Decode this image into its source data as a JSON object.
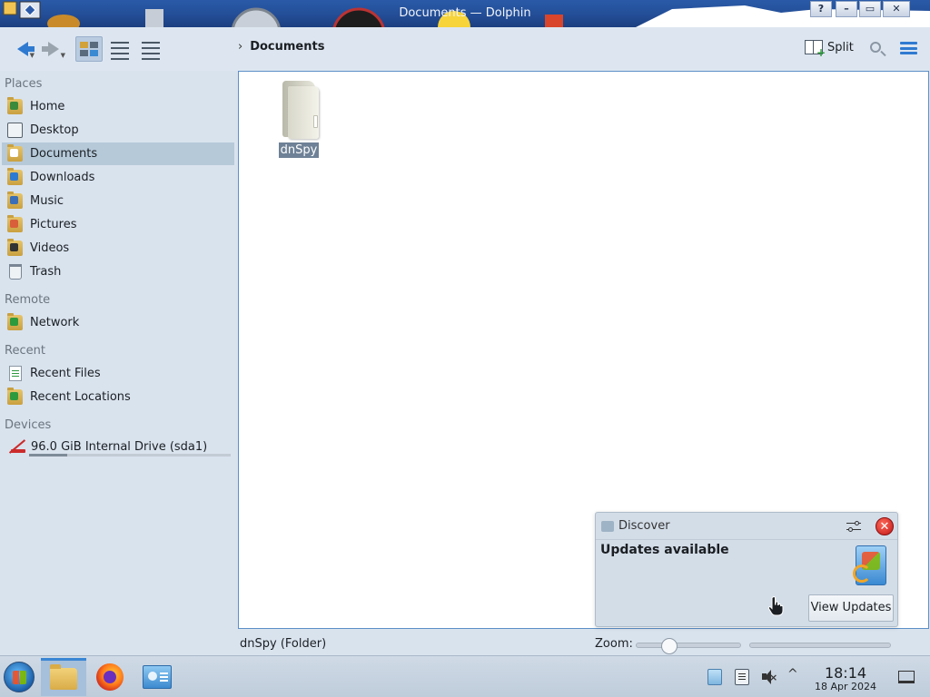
{
  "window": {
    "title": "Documents — Dolphin",
    "buttons": {
      "help": "?",
      "minimize": "–",
      "maximize": "▭",
      "close": "✕"
    }
  },
  "toolbar": {
    "back_icon": "arrow-left-icon",
    "forward_icon": "arrow-right-icon",
    "view_modes": [
      "icons",
      "compact",
      "details"
    ],
    "active_view": "icons",
    "breadcrumb": [
      "Documents"
    ],
    "split_label": "Split",
    "search_icon": "search-icon",
    "menu_icon": "hamburger-menu-icon"
  },
  "sidebar": {
    "sections": {
      "places": "Places",
      "remote": "Remote",
      "recent": "Recent",
      "devices": "Devices"
    },
    "places": [
      {
        "label": "Home",
        "icon": "home-folder-icon"
      },
      {
        "label": "Desktop",
        "icon": "desktop-icon"
      },
      {
        "label": "Documents",
        "icon": "documents-folder-icon",
        "selected": true
      },
      {
        "label": "Downloads",
        "icon": "downloads-folder-icon"
      },
      {
        "label": "Music",
        "icon": "music-folder-icon"
      },
      {
        "label": "Pictures",
        "icon": "pictures-folder-icon"
      },
      {
        "label": "Videos",
        "icon": "videos-folder-icon"
      },
      {
        "label": "Trash",
        "icon": "trash-icon"
      }
    ],
    "remote": [
      {
        "label": "Network",
        "icon": "network-folder-icon"
      }
    ],
    "recent": [
      {
        "label": "Recent Files",
        "icon": "recent-files-icon"
      },
      {
        "label": "Recent Locations",
        "icon": "recent-locations-icon"
      }
    ],
    "devices": [
      {
        "label": "96.0 GiB Internal Drive (sda1)",
        "icon": "drive-icon",
        "usage_fraction": 0.19
      }
    ]
  },
  "main": {
    "items": [
      {
        "name": "dnSpy",
        "type": "folder",
        "selected": true
      }
    ]
  },
  "statusbar": {
    "text": "dnSpy (Folder)",
    "zoom_label": "Zoom:",
    "zoom_fraction": 0.28
  },
  "notification": {
    "app_name": "Discover",
    "summary": "Updates available",
    "action_label": "View Updates",
    "close_glyph": "✕"
  },
  "taskbar": {
    "tasks": [
      {
        "name": "dolphin",
        "icon": "folder-icon",
        "active": true
      },
      {
        "name": "firefox",
        "icon": "firefox-icon",
        "active": false
      },
      {
        "name": "system-settings",
        "icon": "settings-icon",
        "active": false
      }
    ],
    "tray_caret": "^",
    "clock_time": "18:14",
    "clock_date": "18 Apr 2024"
  },
  "colors": {
    "accent": "#2f7ad1",
    "selection": "#b6c9d9",
    "titlebar": "#244f99",
    "notification_close": "#c01515"
  }
}
